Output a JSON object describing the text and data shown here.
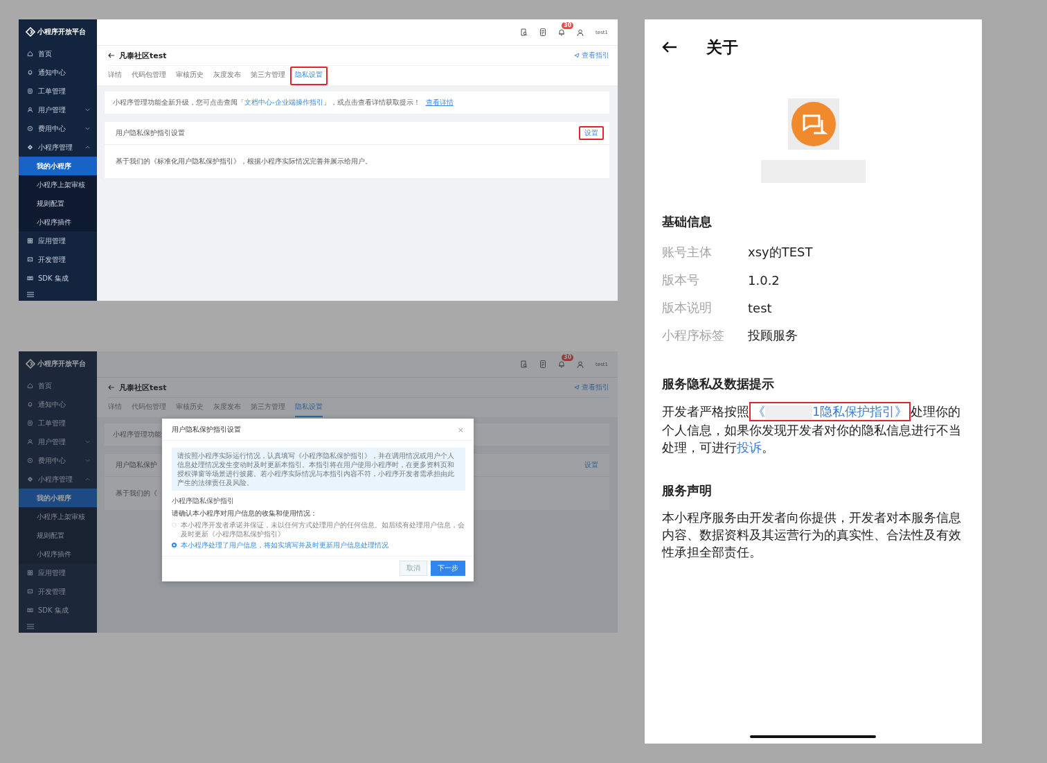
{
  "consoles": [
    {
      "logo": "小程序开放平台",
      "sidebar": [
        {
          "label": "首页",
          "selected": false
        },
        {
          "label": "通知中心",
          "selected": false
        },
        {
          "label": "工单管理",
          "selected": false
        },
        {
          "label": "用户管理",
          "selected": false,
          "expanded": false
        },
        {
          "label": "费用中心",
          "selected": false,
          "expanded": false
        },
        {
          "label": "小程序管理",
          "selected": false,
          "expanded": true,
          "children": [
            {
              "label": "我的小程序",
              "selected": true
            },
            {
              "label": "小程序上架审核",
              "selected": false
            },
            {
              "label": "规则配置",
              "selected": false
            },
            {
              "label": "小程序插件",
              "selected": false
            }
          ]
        },
        {
          "label": "应用管理",
          "selected": false
        },
        {
          "label": "开发管理",
          "selected": false
        },
        {
          "label": "SDK 集成",
          "selected": false
        }
      ],
      "header": {
        "badge": "30",
        "user": "test1"
      },
      "page": {
        "title": "凡泰社区test",
        "guide": "查看指引"
      },
      "tabs": [
        {
          "label": "详情",
          "selected": false,
          "annotated": false
        },
        {
          "label": "代码包管理",
          "selected": false,
          "annotated": false
        },
        {
          "label": "审核历史",
          "selected": false,
          "annotated": false
        },
        {
          "label": "灰度发布",
          "selected": false,
          "annotated": false
        },
        {
          "label": "第三方管理",
          "selected": false,
          "annotated": false
        },
        {
          "label": "隐私设置",
          "selected": true,
          "annotated": true
        }
      ],
      "notice": [
        {
          "kind": "plain",
          "text": "小程序管理功能全新升级，您可点击查阅「"
        },
        {
          "kind": "link",
          "text": "文档中心-企业端操作指引"
        },
        {
          "kind": "plain",
          "text": "」，或点击查看详情获取提示！"
        },
        {
          "kind": "link",
          "text": "查看详情"
        }
      ],
      "section": {
        "title": "用户隐私保护指引设置",
        "button": {
          "label": "设置",
          "annotated": true
        },
        "description": "基于我们的《标准化用户隐私保护指引》，根据小程序实际情况完善并展示给用户。"
      }
    },
    {
      "logo": "小程序开放平台",
      "sidebar": [
        {
          "label": "首页",
          "selected": false
        },
        {
          "label": "通知中心",
          "selected": false
        },
        {
          "label": "工单管理",
          "selected": false
        },
        {
          "label": "用户管理",
          "selected": false,
          "expanded": false
        },
        {
          "label": "费用中心",
          "selected": false,
          "expanded": false
        },
        {
          "label": "小程序管理",
          "selected": false,
          "expanded": true,
          "children": [
            {
              "label": "我的小程序",
              "selected": true
            },
            {
              "label": "小程序上架审核",
              "selected": false
            },
            {
              "label": "规则配置",
              "selected": false
            },
            {
              "label": "小程序插件",
              "selected": false
            }
          ]
        },
        {
          "label": "应用管理",
          "selected": false
        },
        {
          "label": "开发管理",
          "selected": false
        },
        {
          "label": "SDK 集成",
          "selected": false
        }
      ],
      "header": {
        "badge": "30",
        "user": "test1"
      },
      "page": {
        "title": "凡泰社区test",
        "guide": "查看指引"
      },
      "tabs": [
        {
          "label": "详情",
          "selected": false,
          "annotated": false
        },
        {
          "label": "代码包管理",
          "selected": false,
          "annotated": false
        },
        {
          "label": "审核历史",
          "selected": false,
          "annotated": false
        },
        {
          "label": "灰度发布",
          "selected": false,
          "annotated": false
        },
        {
          "label": "第三方管理",
          "selected": false,
          "annotated": false
        },
        {
          "label": "隐私设置",
          "selected": true,
          "annotated": false
        }
      ],
      "notice": [
        {
          "kind": "plain",
          "text": "小程序管理功能"
        }
      ],
      "section": {
        "title": "用户隐私保护",
        "button": {
          "label": "设置",
          "annotated": false
        },
        "description": "基于我们的《"
      },
      "dialog": {
        "title": "用户隐私保护指引设置",
        "close": "×",
        "info": "请按照小程序实际运行情况，认真填写《小程序隐私保护指引》，并在调用情况或用户个人信息处理情况发生变动时及时更新本指引。本指引将在用户使用小程序时，在更多资料页和授权弹窗等场景进行披露。若小程序实际情况与本指引内容不符，小程序开发者需承担由此产生的法律责任及风险。",
        "field_label": "小程序隐私保护指引",
        "question": "请确认本小程序对用户信息的收集和使用情况：",
        "options": [
          {
            "label": "本小程序开发者承诺并保证，未以任何方式处理用户的任何信息。如后续有处理用户信息，会及时更新《小程序隐私保护指引》",
            "selected": false
          },
          {
            "label": "本小程序处理了用户信息，将如实填写并及时更新用户信息处理情况",
            "selected": true
          }
        ],
        "buttons": [
          {
            "label": "取消",
            "kind": "secondary"
          },
          {
            "label": "下一步",
            "kind": "primary"
          }
        ]
      }
    }
  ],
  "phone": {
    "title": "关于",
    "basic": {
      "heading": "基础信息",
      "rows": [
        {
          "label": "账号主体",
          "value": "xsy的TEST"
        },
        {
          "label": "版本号",
          "value": "1.0.2"
        },
        {
          "label": "版本说明",
          "value": "test"
        },
        {
          "label": "小程序标签",
          "value": "投顾服务"
        }
      ]
    },
    "privacy": {
      "heading": "服务隐私及数据提示",
      "parts": [
        {
          "kind": "plain",
          "text": "开发者严格按照"
        },
        {
          "kind": "guide-link",
          "text_start": "《",
          "text_end": "1隐私保护指引》",
          "annotated": true
        },
        {
          "kind": "plain",
          "text": "处理你的个人信息，如果你发现开发者对你的隐私信息进行不当处理，可进行"
        },
        {
          "kind": "link",
          "text": "投诉"
        },
        {
          "kind": "plain",
          "text": "。"
        }
      ]
    },
    "statement": {
      "heading": "服务声明",
      "text": "本小程序服务由开发者向你提供，开发者对本服务信息内容、数据资料及其运营行为的真实性、合法性及有效性承担全部责任。"
    }
  }
}
